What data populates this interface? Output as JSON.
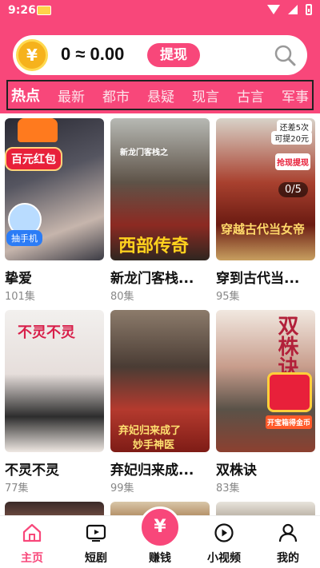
{
  "status_bar": {
    "time": "9:26"
  },
  "coin_bar": {
    "coin_symbol": "¥",
    "balance_text": "0 ≈ 0.00",
    "withdraw_label": "提现"
  },
  "tabs": [
    {
      "label": "热点",
      "active": true
    },
    {
      "label": "最新",
      "active": false
    },
    {
      "label": "都市",
      "active": false
    },
    {
      "label": "悬疑",
      "active": false
    },
    {
      "label": "现言",
      "active": false
    },
    {
      "label": "古言",
      "active": false
    },
    {
      "label": "军事",
      "active": false
    }
  ],
  "dramas": [
    {
      "title": "挚爱",
      "episodes": "101集"
    },
    {
      "title": "新龙门客栈...",
      "episodes": "80集",
      "poster_text": "西部传奇",
      "poster_subtext": "新龙门客栈之"
    },
    {
      "title": "穿到古代当...",
      "episodes": "95集",
      "poster_text": "穿越古代当女帝"
    },
    {
      "title": "不灵不灵",
      "episodes": "77集",
      "poster_text": "不灵不灵"
    },
    {
      "title": "弃妃归来成...",
      "episodes": "99集",
      "poster_text": "弃妃归来成了",
      "poster_text2": "妙手神医"
    },
    {
      "title": "双株诀",
      "episodes": "83集",
      "poster_text": "双株诀"
    }
  ],
  "promos": {
    "red_packet": "百元红包",
    "draw_phone": "抽手机",
    "remaining": "还差5次",
    "can_withdraw": "可提20元",
    "grab_withdraw": "抢现提现",
    "progress": "0/5",
    "treasure_box": "开宝箱得金币"
  },
  "bottom_nav": [
    {
      "label": "主页",
      "icon": "home-icon",
      "active": true
    },
    {
      "label": "短剧",
      "icon": "tv-icon",
      "active": false
    },
    {
      "label": "赚钱",
      "icon": "yuan-icon",
      "active": false
    },
    {
      "label": "小视频",
      "icon": "play-icon",
      "active": false
    },
    {
      "label": "我的",
      "icon": "user-icon",
      "active": false
    }
  ],
  "colors": {
    "brand": "#f8477a",
    "promo_red": "#e8203a"
  }
}
